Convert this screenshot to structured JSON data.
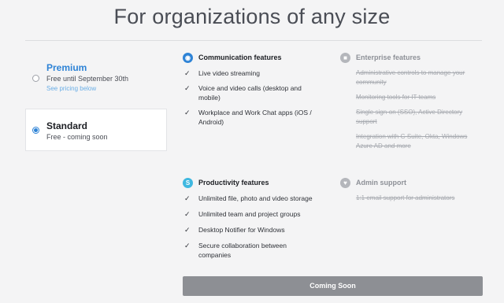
{
  "title": "For organizations of any size",
  "plans": {
    "premium": {
      "name": "Premium",
      "sub": "Free until September 30th",
      "link": "See pricing below"
    },
    "standard": {
      "name": "Standard",
      "sub": "Free - coming soon"
    }
  },
  "communication": {
    "title": "Communication features",
    "items": [
      "Live video streaming",
      "Voice and video calls (desktop and",
      "mobile)",
      "Workplace and Work Chat apps (iOS /",
      "Android)"
    ]
  },
  "productivity": {
    "title": "Productivity features",
    "items": [
      "Unlimited file, photo and video storage",
      "Unlimited team and project groups",
      "Desktop Notifier for Windows",
      "Secure collaboration between",
      "companies"
    ]
  },
  "enterprise": {
    "title": "Enterprise features",
    "items": [
      "Administrative controls to manage your",
      "community",
      "Monitoring tools for IT teams",
      "Single sign-on (SSO), Active Directory",
      "support",
      "Integration with G Suite, Okta, Windows",
      "Azure AD and more"
    ]
  },
  "admin": {
    "title": "Admin support",
    "items": [
      "1:1 email support for administrators"
    ]
  },
  "cta": {
    "label": "Coming Soon"
  },
  "colors": {
    "accent": "#2e83d6",
    "button": "#8d8f94",
    "muted": "#a7aab0"
  }
}
